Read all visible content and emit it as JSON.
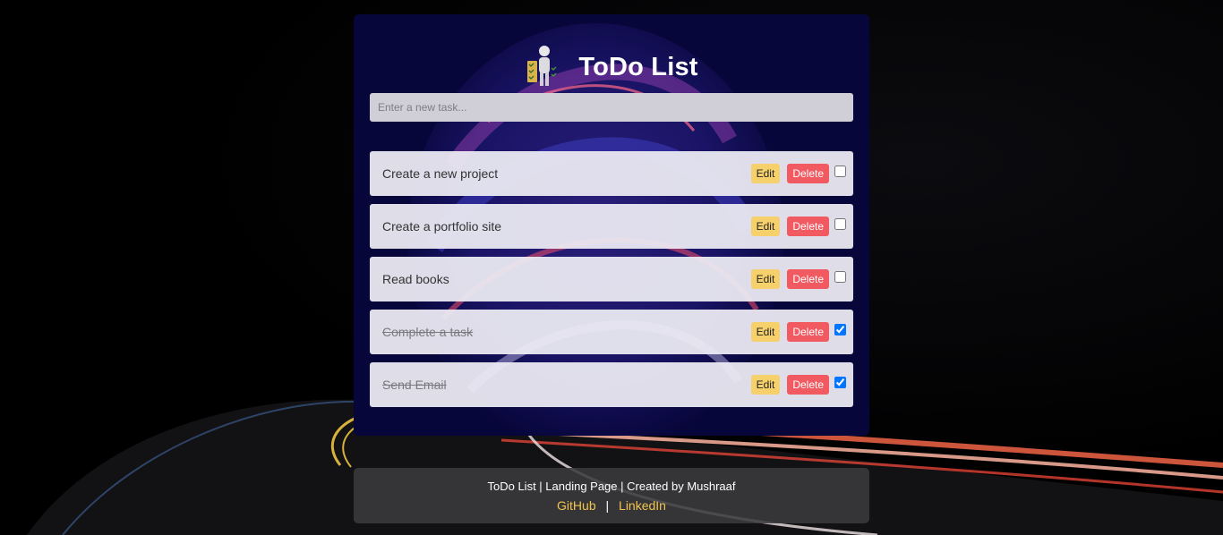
{
  "app": {
    "title": "ToDo List"
  },
  "input": {
    "placeholder": "Enter a new task...",
    "value": ""
  },
  "tasks": [
    {
      "text": "Create a new project",
      "done": false
    },
    {
      "text": "Create a portfolio site",
      "done": false
    },
    {
      "text": "Read books",
      "done": false
    },
    {
      "text": "Complete a task",
      "done": true
    },
    {
      "text": "Send Email",
      "done": true
    }
  ],
  "task_actions": {
    "edit_label": "Edit",
    "delete_label": "Delete"
  },
  "footer": {
    "credit": "ToDo List | Landing Page | Created by Mushraaf",
    "github_label": "GitHub",
    "separator": "|",
    "linkedin_label": "LinkedIn"
  },
  "colors": {
    "card_bg": "#07063a",
    "edit_button": "#f6d06a",
    "delete_button": "#f25a62",
    "link": "#f2c54d"
  },
  "icons": {
    "logo": "person-with-checklist-icon"
  }
}
